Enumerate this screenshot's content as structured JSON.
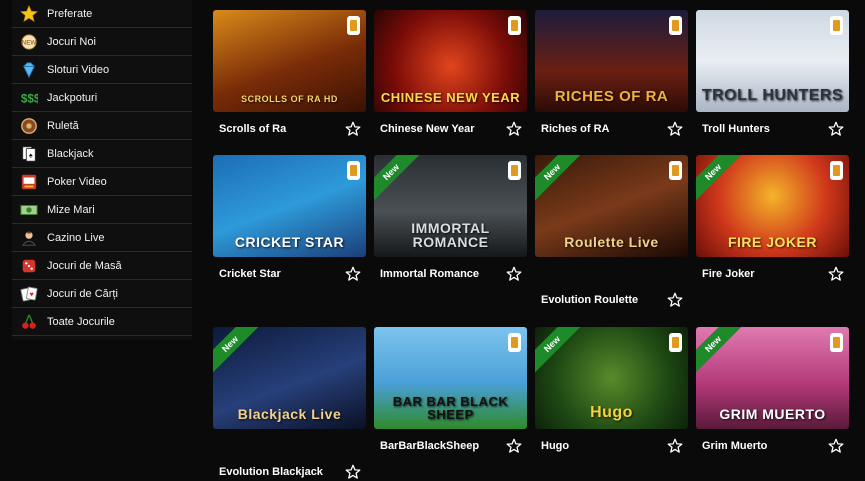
{
  "sidebar": {
    "items": [
      {
        "label": "Preferate",
        "icon": "star-icon"
      },
      {
        "label": "Jocuri Noi",
        "icon": "new-badge-icon"
      },
      {
        "label": "Sloturi Video",
        "icon": "diamond-icon"
      },
      {
        "label": "Jackpoturi",
        "icon": "money-icon"
      },
      {
        "label": "Ruletă",
        "icon": "roulette-icon"
      },
      {
        "label": "Blackjack",
        "icon": "cards-icon"
      },
      {
        "label": "Poker Video",
        "icon": "poker-machine-icon"
      },
      {
        "label": "Mize Mari",
        "icon": "cash-icon"
      },
      {
        "label": "Cazino Live",
        "icon": "dealer-icon"
      },
      {
        "label": "Jocuri de Masă",
        "icon": "dice-icon"
      },
      {
        "label": "Jocuri de Cărți",
        "icon": "playing-cards-icon"
      },
      {
        "label": "Toate Jocurile",
        "icon": "cherries-icon"
      }
    ]
  },
  "games": [
    {
      "name": "Scrolls of Ra",
      "art": "SCROLLS OF RA HD",
      "new_label": "",
      "mobile": true
    },
    {
      "name": "Chinese New Year",
      "art": "CHINESE NEW YEAR",
      "new_label": "",
      "mobile": true
    },
    {
      "name": "Riches of RA",
      "art": "RICHES OF RA",
      "new_label": "",
      "mobile": true
    },
    {
      "name": "Troll Hunters",
      "art": "TROLL HUNTERS",
      "new_label": "",
      "mobile": true
    },
    {
      "name": "Cricket Star",
      "art": "CRICKET STAR",
      "new_label": "",
      "mobile": true
    },
    {
      "name": "Immortal Romance",
      "art": "IMMORTAL ROMANCE",
      "new_label": "New",
      "mobile": true
    },
    {
      "name": "Evolution Roulette",
      "art": "Roulette Live",
      "new_label": "New",
      "mobile": true
    },
    {
      "name": "Fire Joker",
      "art": "FIRE JOKER",
      "new_label": "New",
      "mobile": true
    },
    {
      "name": "Evolution Blackjack",
      "art": "Blackjack Live",
      "new_label": "New",
      "mobile": false
    },
    {
      "name": "BarBarBlackSheep",
      "art": "BAR BAR BLACK SHEEP",
      "new_label": "",
      "mobile": true
    },
    {
      "name": "Hugo",
      "art": "Hugo",
      "new_label": "New",
      "mobile": true
    },
    {
      "name": "Grim Muerto",
      "art": "GRIM MUERTO",
      "new_label": "New",
      "mobile": true
    }
  ],
  "colors": {
    "favorite_star": "#ffffff",
    "new_ribbon": "#1e8a2a",
    "mobile_badge": "#e09b1f"
  }
}
